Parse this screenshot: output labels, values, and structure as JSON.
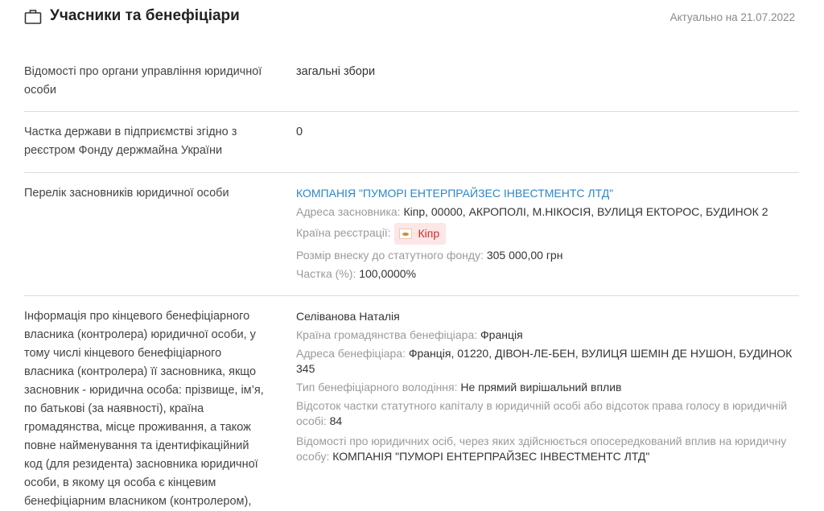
{
  "header": {
    "title": "Учасники та бенефіціари",
    "date": "Актуально на 21.07.2022"
  },
  "rows": [
    {
      "label": "Відомості про органи управління юридичної особи",
      "value": "загальні збори"
    },
    {
      "label": "Частка держави в підприємстві згідно з реєстром Фонду держмайна України",
      "value": "0"
    },
    {
      "label": "Перелік засновників юридичної особи",
      "founder": {
        "name": "КОМПАНІЯ \"ПУМОРІ ЕНТЕРПРАЙЗЕС ІНВЕСТМЕНТС ЛТД\"",
        "address_label": "Адреса засновника:",
        "address": "Кіпр, 00000, АКРОПОЛІ, М.НІКОСІЯ, ВУЛИЦЯ ЕКТОРОС, БУДИНОК 2",
        "country_label": "Країна реєстрації:",
        "country": "Кіпр",
        "capital_label": "Розмір внеску до статутного фонду:",
        "capital": "305 000,00 грн",
        "share_label": "Частка (%):",
        "share": "100,0000%"
      }
    },
    {
      "label": "Інформація про кінцевого бенефіціарного власника (контролера) юридичної особи, у тому числі кінцевого бенефіціарного власника (контролера) її засновника, якщо засновник - юридична особа: прізвище, ім’я, по батькові (за наявності), країна громадянства, місце проживання, а також повне найменування та ідентифікаційний код (для резидента) засновника юридичної особи, в якому ця особа є кінцевим бенефіціарним власником (контролером),",
      "beneficiary": {
        "name": "Селіванова Наталія",
        "citizenship_label": "Країна громадянства бенефіціара:",
        "citizenship": "Франція",
        "address_label": "Адреса бенефіціара:",
        "address": "Франція, 01220, ДІВОН-ЛЕ-БЕН, ВУЛИЦЯ ШЕМІН ДЕ НУШОН, БУДИНОК 345",
        "ownership_type_label": "Тип бенефіціарного володіння:",
        "ownership_type": "Не прямий вирішальний вплив",
        "capital_percent_label": "Відсоток частки статутного капіталу в юридичній особі або відсоток права голосу в юридичній особі:",
        "capital_percent": "84",
        "indirect_label": "Відомості про юридичних осіб, через яких здійснюється опосередкований вплив на юридичну особу:",
        "indirect": "КОМПАНІЯ \"ПУМОРІ ЕНТЕРПРАЙЗЕС ІНВЕСТМЕНТС ЛТД\""
      }
    }
  ]
}
